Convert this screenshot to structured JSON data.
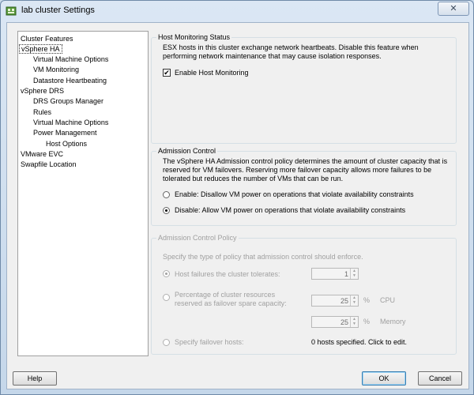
{
  "window": {
    "title": "lab cluster Settings",
    "close_glyph": "✕"
  },
  "nav": {
    "items": [
      {
        "label": "Cluster Features"
      },
      {
        "label": "vSphere HA",
        "selected": true
      },
      {
        "label": "Virtual Machine Options"
      },
      {
        "label": "VM Monitoring"
      },
      {
        "label": "Datastore Heartbeating"
      },
      {
        "label": "vSphere DRS"
      },
      {
        "label": "DRS Groups Manager"
      },
      {
        "label": "Rules"
      },
      {
        "label": "Virtual Machine Options"
      },
      {
        "label": "Power Management"
      },
      {
        "label": "Host Options"
      },
      {
        "label": "VMware EVC"
      },
      {
        "label": "Swapfile Location"
      }
    ]
  },
  "host_monitoring": {
    "legend": "Host Monitoring Status",
    "description_1": "ESX hosts in this cluster exchange network heartbeats. Disable this feature when",
    "description_2": "performing network maintenance that may cause isolation responses.",
    "checkbox_label": "Enable Host Monitoring",
    "checkbox_checked": true,
    "check_glyph": "✔"
  },
  "admission_control": {
    "legend": "Admission Control",
    "description_1": "The vSphere HA Admission control policy determines the amount of cluster capacity that is",
    "description_2": "reserved for VM failovers. Reserving more failover capacity allows more failures to be",
    "description_3": "tolerated but reduces the number of VMs that can be run.",
    "enable_label": "Enable: Disallow VM power on operations that violate availability constraints",
    "disable_label": "Disable: Allow VM power on operations that violate availability constraints",
    "selected": "disable"
  },
  "policy": {
    "legend": "Admission Control Policy",
    "description": "Specify the type of policy that admission control should enforce.",
    "host_failures_label": "Host failures the cluster tolerates:",
    "host_failures_value": "1",
    "percentage_label_1": "Percentage of cluster resources",
    "percentage_label_2": "reserved as failover spare capacity:",
    "cpu_value": "25",
    "cpu_unit": "%",
    "cpu_label": "CPU",
    "memory_value": "25",
    "memory_unit": "%",
    "memory_label": "Memory",
    "failover_hosts_label": "Specify failover hosts:",
    "failover_hosts_status": "0 hosts specified. Click to edit.",
    "selected": "host_failures",
    "enabled": false
  },
  "buttons": {
    "help": "Help",
    "ok": "OK",
    "cancel": "Cancel"
  },
  "colors": {
    "title_gradient_top": "#dbe7f4",
    "client_bg": "#f0f0f0",
    "disabled_text": "#a0a0a0",
    "default_button_border": "#3c7fb1"
  }
}
